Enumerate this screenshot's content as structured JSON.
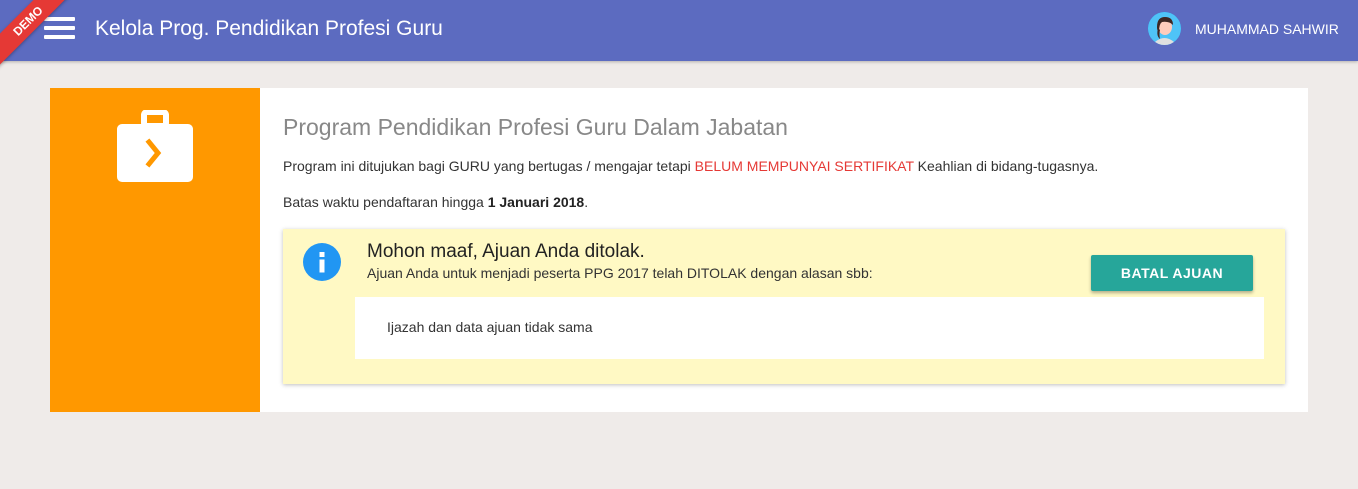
{
  "header": {
    "demo_badge": "DEMO",
    "title": "Kelola Prog. Pendidikan Profesi Guru",
    "user_name": "MUHAMMAD SAHWIR",
    "menu_icon": "hamburger-menu-icon",
    "avatar_icon": "user-avatar-icon"
  },
  "program": {
    "icon": "briefcase-arrow-icon",
    "title": "Program Pendidikan Profesi Guru Dalam Jabatan",
    "description_before": "Program ini ditujukan bagi GURU yang bertugas / mengajar tetapi ",
    "description_highlight": "BELUM MEMPUNYAI SERTIFIKAT",
    "description_after": " Keahlian di bidang-tugasnya.",
    "deadline_label": "Batas waktu pendaftaran hingga ",
    "deadline_date": "1 Januari 2018",
    "deadline_end": "."
  },
  "alert": {
    "icon": "info-icon",
    "title": "Mohon maaf, Ajuan Anda ditolak.",
    "subtitle": "Ajuan Anda untuk menjadi peserta PPG 2017 telah DITOLAK dengan alasan sbb:",
    "cancel_label": "BATAL AJUAN",
    "reason": "Ijazah dan data ajuan tidak sama"
  },
  "colors": {
    "topbar": "#5c6bc0",
    "ribbon": "#e53935",
    "sidebar": "#ff9800",
    "alert_bg": "#fff9c4",
    "button": "#26a69a",
    "warning_text": "#e53935",
    "info_icon": "#2196f3",
    "page_bg": "#efebe9"
  }
}
